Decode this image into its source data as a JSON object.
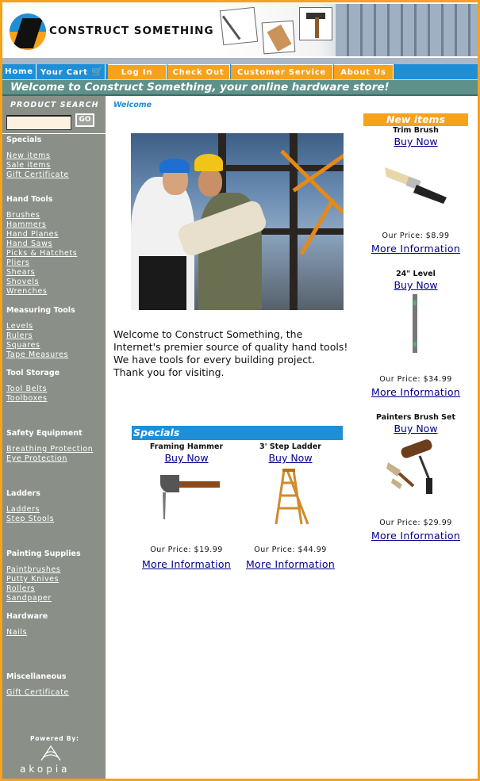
{
  "brand": {
    "name": "CONSTRUCT SOMETHING"
  },
  "nav": [
    {
      "label": "Home"
    },
    {
      "label": "Your Cart"
    },
    {
      "label": "Log In"
    },
    {
      "label": "Check Out"
    },
    {
      "label": "Customer Service"
    },
    {
      "label": "About Us"
    }
  ],
  "welcome_banner": "Welcome to Construct Something, your online hardware store!",
  "sidebar": {
    "search_label": "PRODUCT SEARCH",
    "search_value": "",
    "go_label": "GO",
    "categories": [
      {
        "title": "Specials",
        "links": [
          "New items",
          "Sale items",
          "Gift Certificate"
        ]
      },
      {
        "title": "Hand Tools",
        "links": [
          "Brushes",
          "Hammers",
          "Hand Planes",
          "Hand Saws",
          "Picks & Hatchets",
          "Pliers",
          "Shears",
          "Shovels",
          "Wrenches"
        ]
      },
      {
        "title": "Measuring Tools",
        "links": [
          "Levels",
          "Rulers",
          "Squares",
          "Tape Measures"
        ]
      },
      {
        "title": "Tool Storage",
        "links": [
          "Tool Belts",
          "Toolboxes"
        ]
      },
      {
        "title": "Safety Equipment",
        "links": [
          "Breathing Protection",
          "Eye Protection"
        ]
      },
      {
        "title": "Ladders",
        "links": [
          "Ladders",
          "Step Stools"
        ]
      },
      {
        "title": "Painting Supplies",
        "links": [
          "Paintbrushes",
          "Putty Knives",
          "Rollers",
          "Sandpaper"
        ]
      },
      {
        "title": "Hardware",
        "links": [
          "Nails"
        ]
      },
      {
        "title": "Miscellaneous",
        "links": [
          "Gift Certificate"
        ]
      }
    ],
    "powered_by": "Powered By:",
    "powered_brand": "akopia"
  },
  "main": {
    "crumb": "Welcome",
    "welcome_lines": [
      "Welcome to Construct Something, the",
      "Internet's premier source of quality hand tools!",
      "We have tools for every building project.",
      "Thank you for visiting."
    ],
    "specials": {
      "title": "Specials",
      "items": [
        {
          "name": "Framing Hammer",
          "buy": "Buy Now",
          "price": "Our Price: $19.99",
          "more": "More Information",
          "icon": "hammer-icon"
        },
        {
          "name": "3' Step Ladder",
          "buy": "Buy Now",
          "price": "Our Price: $44.99",
          "more": "More Information",
          "icon": "ladder-icon"
        }
      ]
    }
  },
  "new_items": {
    "title": "New items",
    "items": [
      {
        "name": "Trim Brush",
        "buy": "Buy Now",
        "price": "Our Price: $8.99",
        "more": "More Information",
        "icon": "brush-icon"
      },
      {
        "name": "24\" Level",
        "buy": "Buy Now",
        "price": "Our Price: $34.99",
        "more": "More Information",
        "icon": "level-icon"
      },
      {
        "name": "Painters Brush Set",
        "buy": "Buy Now",
        "price": "Our Price: $29.99",
        "more": "More Information",
        "icon": "brush-set-icon"
      }
    ]
  },
  "colors": {
    "border": "#f7a21b",
    "nav_blue": "#1e8fd6",
    "banner_teal": "#5e9189",
    "sidebar": "#8a9088",
    "link": "#00008b"
  }
}
